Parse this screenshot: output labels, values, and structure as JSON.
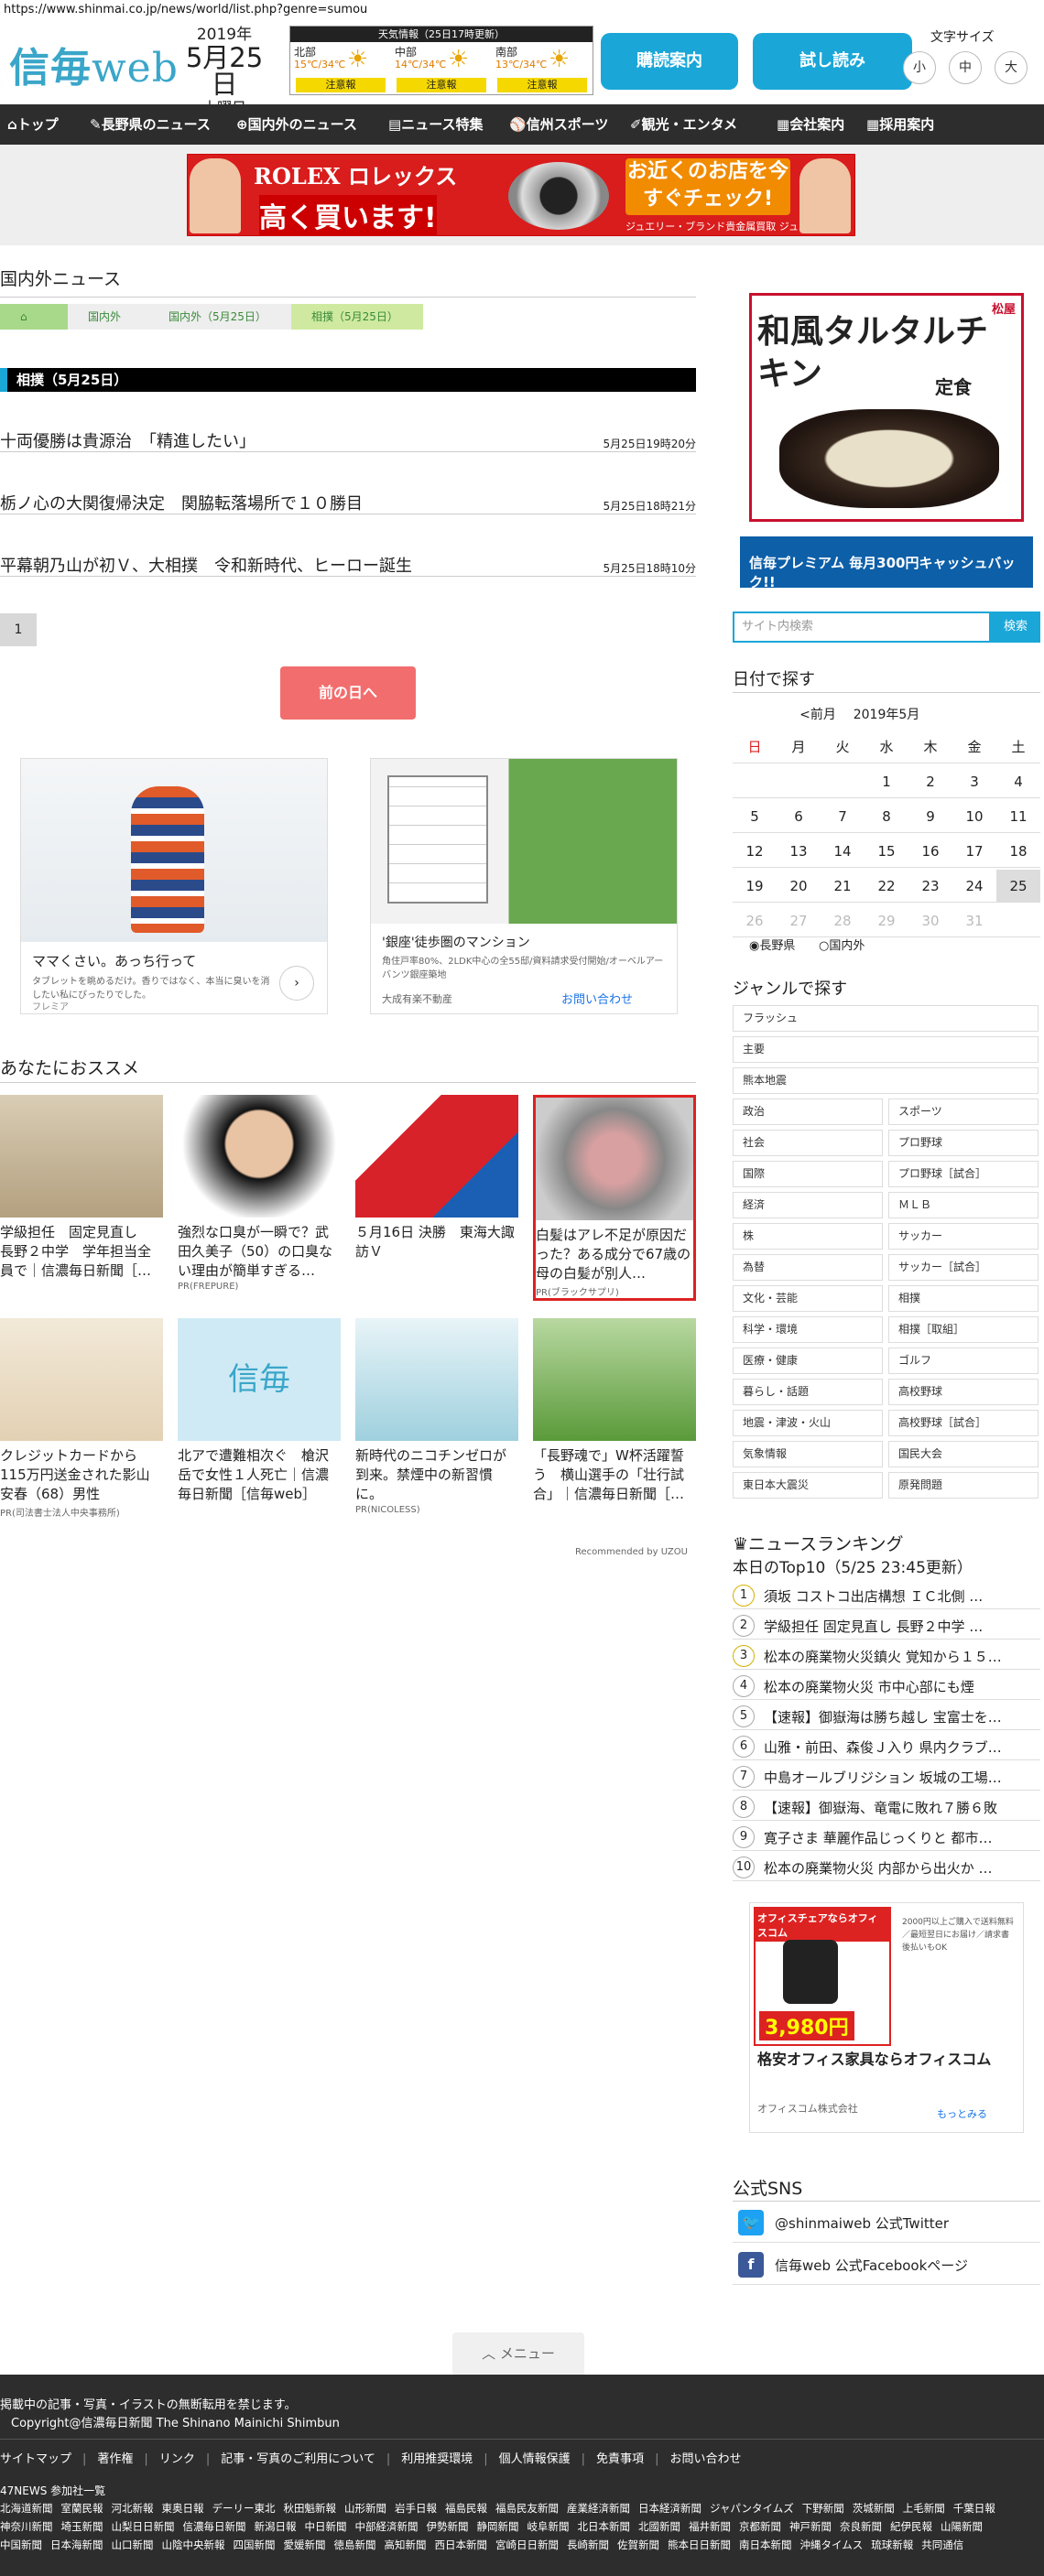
{
  "url": "https://www.shinmai.co.jp/news/world/list.php?genre=sumou",
  "header": {
    "logo_a": "信毎",
    "logo_b": "web",
    "year": "2019年",
    "date": "5月25日",
    "weekday": "土曜日",
    "weather": {
      "title": "天気情報（25日17時更新）",
      "regions": [
        {
          "name": "北部",
          "temp": "15℃/34℃",
          "warn": "注意報"
        },
        {
          "name": "中部",
          "temp": "14℃/34℃",
          "warn": "注意報"
        },
        {
          "name": "南部",
          "temp": "13℃/34℃",
          "warn": "注意報"
        }
      ]
    },
    "btn_subscribe": "購読案内",
    "btn_trial": "試し読み",
    "fontsize_label": "文字サイズ",
    "fontsizes": [
      "小",
      "中",
      "大"
    ]
  },
  "nav": [
    "トップ",
    "長野県のニュース",
    "国内外のニュース",
    "ニュース特集",
    "信州スポーツ",
    "観光・エンタメ",
    "会社案内",
    "採用案内"
  ],
  "banner": {
    "brand": "ROLEX ロレックス",
    "buy": "高く買います!",
    "shop": "お近くのお店を今すぐチェック!",
    "shopname": "ジュエリー・ブランド貴金属買取 ジュエルカフェ"
  },
  "section_title": "国内外ニュース",
  "breadcrumb": [
    "国内外",
    "国内外（5月25日）",
    "相撲（5月25日）"
  ],
  "category": "相撲（5月25日）",
  "articles": [
    {
      "title": "十両優勝は貴源治　「精進したい」",
      "date": "5月25日19時20分"
    },
    {
      "title": "栃ノ心の大関復帰決定　関脇転落場所で１０勝目",
      "date": "5月25日18時21分"
    },
    {
      "title": "平幕朝乃山が初Ｖ、大相撲　令和新時代、ヒーロー誕生",
      "date": "5月25日18時10分"
    }
  ],
  "page": "1",
  "prev_day": "前の日へ",
  "gad1": {
    "title": "ママくさい。あっち行って",
    "body": "タブレットを眺めるだけ。香りではなく、本当に臭いを消したい私にぴったりでした。",
    "src": "フレミア"
  },
  "gad2": {
    "title": "'銀座'徒歩圏のマンション",
    "body": "角住戸率80%、2LDK中心の全55邸/資料請求受付開始/オーベルアーバンツ銀座築地",
    "src": "大成有楽不動産",
    "cta": "お問い合わせ"
  },
  "rec_title": "あなたにおススメ",
  "recs": [
    {
      "cap": "学級担任　固定見直し　長野２中学　学年担当全員で｜信濃毎日新聞［…",
      "pr": ""
    },
    {
      "cap": "強烈な口臭が一瞬で？武田久美子（50）の口臭ない理由が簡単すぎる…",
      "pr": "PR(FREPURE)"
    },
    {
      "cap": "５月16日 決勝　東海大諏訪Ｖ",
      "pr": ""
    },
    {
      "cap": "白髪はアレ不足が原因だった？ある成分で67歳の母の白髪が別人…",
      "pr": "PR(ブラックサプリ)"
    },
    {
      "cap": "クレジットカードから115万円送金された影山安春（68）男性",
      "pr": "PR(司法書士法人中央事務所)"
    },
    {
      "cap": "北アで遭難相次ぐ　槍沢岳で女性１人死亡｜信濃毎日新聞［信毎web］",
      "pr": ""
    },
    {
      "cap": "新時代のニコチンゼロが到来。禁煙中の新習慣に。",
      "pr": "PR(NICOLESS)"
    },
    {
      "cap": "「長野魂で」W杯活躍誓う　横山選手の「壮行試合」｜信濃毎日新聞［…",
      "pr": ""
    }
  ],
  "uzou": "Recommended by UZOU",
  "sidead": {
    "title": "和風タルタルチキン",
    "sub": "定食",
    "brand": "松屋"
  },
  "smallad": {
    "text": "信毎プレミアム 毎月300円キャッシュバック!!"
  },
  "search": {
    "placeholder": "サイト内検索",
    "btn": "検索"
  },
  "calendar": {
    "title": "日付で探す",
    "prev": "<前月",
    "month": "2019年5月",
    "weekdays": [
      "日",
      "月",
      "火",
      "水",
      "木",
      "金",
      "土"
    ],
    "rows": [
      [
        "",
        "",
        "",
        "1",
        "2",
        "3",
        "4"
      ],
      [
        "5",
        "6",
        "7",
        "8",
        "9",
        "10",
        "11"
      ],
      [
        "12",
        "13",
        "14",
        "15",
        "16",
        "17",
        "18"
      ],
      [
        "19",
        "20",
        "21",
        "22",
        "23",
        "24",
        "25"
      ],
      [
        "26",
        "27",
        "28",
        "29",
        "30",
        "31",
        ""
      ]
    ],
    "radio": [
      "長野県",
      "国内外"
    ]
  },
  "genre": {
    "title": "ジャンルで探す",
    "full": [
      "フラッシュ",
      "主要",
      "熊本地震"
    ],
    "pairs": [
      [
        "政治",
        "スポーツ"
      ],
      [
        "社会",
        "プロ野球"
      ],
      [
        "国際",
        "プロ野球［試合］"
      ],
      [
        "経済",
        "ＭＬＢ"
      ],
      [
        "株",
        "サッカー"
      ],
      [
        "為替",
        "サッカー［試合］"
      ],
      [
        "文化・芸能",
        "相撲"
      ],
      [
        "科学・環境",
        "相撲［取組］"
      ],
      [
        "医療・健康",
        "ゴルフ"
      ],
      [
        "暮らし・話題",
        "高校野球"
      ],
      [
        "地震・津波・火山",
        "高校野球［試合］"
      ],
      [
        "気象情報",
        "国民大会"
      ],
      [
        "東日本大震災",
        "原発問題"
      ]
    ]
  },
  "ranking": {
    "title": "ニュースランキング",
    "sub": "本日のTop10（5/25 23:45更新）",
    "items": [
      "須坂 コストコ出店構想 ＩＣ北側 …",
      "学級担任 固定見直し 長野２中学 …",
      "松本の廃業物火災鎮火 覚知から１５…",
      "松本の廃業物火災 市中心部にも煙",
      "【速報】御嶽海は勝ち越し 宝富士を…",
      "山雅・前田、森俊Ｊ入り 県内クラブ…",
      "中島オールブリジション 坂城の工場…",
      "【速報】御嶽海、竜電に敗れ７勝６敗",
      "寛子さま 華麗作品じっくりと 都市…",
      "松本の廃業物火災 内部から出火か …"
    ]
  },
  "officead": {
    "ribbon": "オフィスチェアならオフィスコム",
    "price": "3,980円",
    "side": "2000円以上ご購入で送料無料／最短翌日にお届け／請求書後払いもOK",
    "title": "格安オフィス家具ならオフィスコム",
    "company": "オフィスコム株式会社",
    "more": "もっとみる"
  },
  "sns": {
    "title": "公式SNS",
    "items": [
      "@shinmaiweb 公式Twitter",
      "信毎web 公式Facebookページ"
    ]
  },
  "menu": "メニュー",
  "footer": {
    "notice": "掲載中の記事・写真・イラストの無断転用を禁じます。",
    "copyright": "Copyright@信濃毎日新聞 The Shinano Mainichi Shimbun",
    "links": [
      "サイトマップ",
      "著作権",
      "リンク",
      "記事・写真のご利用について",
      "利用推奨環境",
      "個人情報保護",
      "免責事項",
      "お問い合わせ"
    ],
    "t47": "47NEWS 参加社一覧",
    "papers": [
      "北海道新聞",
      "室蘭民報",
      "河北新報",
      "東奥日報",
      "デーリー東北",
      "秋田魁新報",
      "山形新聞",
      "岩手日報",
      "福島民報",
      "福島民友新聞",
      "産業経済新聞",
      "日本経済新聞",
      "ジャパンタイムズ",
      "下野新聞",
      "茨城新聞",
      "上毛新聞",
      "千葉日報",
      "神奈川新聞",
      "埼玉新聞",
      "山梨日日新聞",
      "信濃毎日新聞",
      "新潟日報",
      "中日新聞",
      "中部経済新聞",
      "伊勢新聞",
      "静岡新聞",
      "岐阜新聞",
      "北日本新聞",
      "北國新聞",
      "福井新聞",
      "京都新聞",
      "神戸新聞",
      "奈良新聞",
      "紀伊民報",
      "山陽新聞",
      "中国新聞",
      "日本海新聞",
      "山口新聞",
      "山陰中央新報",
      "四国新聞",
      "愛媛新聞",
      "徳島新聞",
      "高知新聞",
      "西日本新聞",
      "宮崎日日新聞",
      "長崎新聞",
      "佐賀新聞",
      "熊本日日新聞",
      "南日本新聞",
      "沖縄タイムス",
      "琉球新報",
      "共同通信"
    ]
  }
}
